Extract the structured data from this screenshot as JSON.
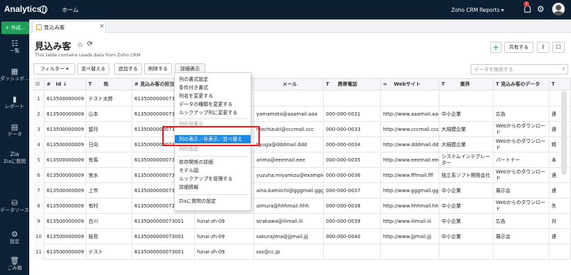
{
  "app": {
    "title": "Analytics",
    "home": "ホーム",
    "reports_menu": "Zoho CRM Reports",
    "notification_count": "5"
  },
  "sidebar": {
    "new_label": "+ 作成...",
    "items": [
      {
        "label": "一覧",
        "icon": "list-icon",
        "glyph": "☷"
      },
      {
        "label": "ダッシュボ...",
        "icon": "dashboard-icon",
        "glyph": "▦"
      },
      {
        "label": "レポート",
        "icon": "report-icon",
        "glyph": "▮"
      },
      {
        "label": "データ",
        "icon": "data-icon",
        "glyph": "▤"
      },
      {
        "label": "Ziaに質問",
        "icon": "zia-icon",
        "glyph": "Zia"
      },
      {
        "label": "データソース",
        "icon": "datasource-icon",
        "glyph": "⛁"
      },
      {
        "label": "設定",
        "icon": "settings-icon",
        "glyph": "⚙"
      },
      {
        "label": "ごみ箱",
        "icon": "trash-icon",
        "glyph": "🗑"
      }
    ]
  },
  "tab": {
    "label": "見込み客"
  },
  "page": {
    "title": "見込み客",
    "subtitle": "This table contains Leads data from Zoho CRM",
    "share": "共有する"
  },
  "toolbar": {
    "filter": "フィルター",
    "sort": "並べ替える",
    "add": "追加する",
    "delete": "削除する",
    "details": "詳細表示"
  },
  "search": {
    "placeholder": "データを検索する"
  },
  "table": {
    "headers": [
      "#",
      "Id",
      "姓",
      "見込み客の担当者",
      "",
      "メール",
      "携帯電話",
      "Webサイト",
      "業界",
      "見込み客のデータ",
      ""
    ],
    "rows": [
      [
        "1",
        "613500000009",
        "テスト太郎",
        "6135000000073",
        "",
        "",
        "",
        "",
        "",
        "",
        ""
      ],
      [
        "2",
        "613500000009",
        "山本",
        "6135000000073",
        "",
        "yamamoto@aaamail.aaa",
        "000-000-0031",
        "http://www.aaamail.aaa",
        "中小企業",
        "広告",
        "連"
      ],
      [
        "3",
        "613500000009",
        "望月",
        "6135000000073",
        "",
        "mochizuki@cccmail.ccc",
        "000-000-0033",
        "http://www.cccmail.ccc",
        "大規模企業",
        "Webからのダウンロード",
        "連"
      ],
      [
        "4",
        "613500000009",
        "日向",
        "6135000000073",
        "",
        "hyuga@dddmail.ddd",
        "000-000-0034",
        "http://www.dddmail.ddd",
        "大規模企業",
        "Webからのダウンロード",
        "精"
      ],
      [
        "5",
        "613500000009",
        "有馬",
        "6135000000073",
        "",
        "arima@eeemail.eee",
        "000-000-0035",
        "http://www.eeemail.eee",
        "システムインテグレーター",
        "パートナー",
        "未"
      ],
      [
        "6",
        "613500000009",
        "宮水",
        "6135000000073",
        "",
        "yuzuha.miyamizu@example.com",
        "000-000-0036",
        "http://www.fffmail.fff",
        "独立系ソフト開発会社",
        "Webからのダウンロード",
        "連"
      ],
      [
        "7",
        "613500000009",
        "上市",
        "6135000000073",
        "",
        "aina.kamiichi@gggmail.ggg",
        "000-000-0037",
        "http://www.gggmail.ggg",
        "中小企業",
        "展示会",
        "連"
      ],
      [
        "8",
        "613500000009",
        "有村",
        "6135000000073001",
        "funai-zh-09",
        "aimura@hhhmail.hhh",
        "000-000-0038",
        "http://www.hhhmail.hhh",
        "中小企業",
        "Webからのダウンロード",
        "失"
      ],
      [
        "9",
        "613500000009",
        "白川",
        "6135000000073001",
        "funai-zh-09",
        "sirakawa@iiimail.iii",
        "000-000-0039",
        "http://www.iiimail.iii",
        "中小企業",
        "広告",
        "対"
      ],
      [
        "10",
        "613500000009",
        "桜島",
        "6135000000073001",
        "funai-zh-09",
        "sakurajima@jjjmail.jjj",
        "000-000-0040",
        "http://www.jjjmail.jjj",
        "中小企業",
        "展示会",
        "連"
      ],
      [
        "11",
        "613500000009",
        "テスト",
        "6135000000073001",
        "funai-zh-09",
        "sss@cc.jp",
        "",
        "",
        "",
        "",
        ""
      ]
    ]
  },
  "menu": {
    "items": [
      "列の書式設定",
      "条件付き書式",
      "列名を変更する",
      "データの種類を変更する",
      "ルックアップ列に変更する",
      "列の非表示",
      "列の表示／非表示／並べ替え",
      "列の固定",
      "依存関係の詳細",
      "モデル図",
      "ルックアップを管理する",
      "詳細情報",
      "Ziaに質問の設定"
    ],
    "highlighted": "列の表示／非表示／並べ替え"
  }
}
